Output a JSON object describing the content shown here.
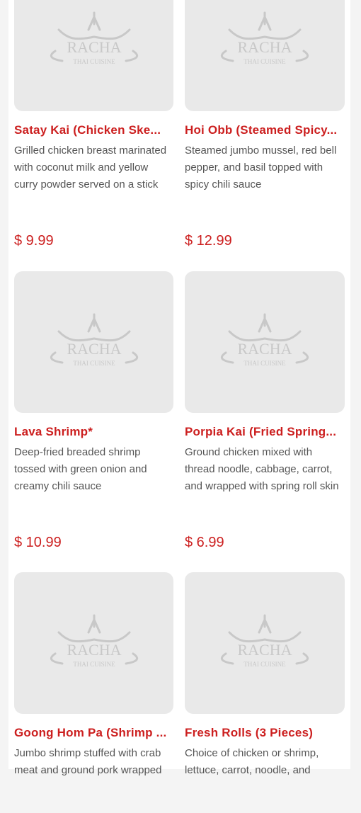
{
  "logo": {
    "brand": "RACHA",
    "subtitle": "THAI CUISINE"
  },
  "menu_items": [
    {
      "name": "Satay Kai (Chicken Ske...",
      "description": "Grilled chicken breast marinated with coconut milk and yellow curry powder served on a stick",
      "price": "$ 9.99"
    },
    {
      "name": "Hoi Obb (Steamed Spicy...",
      "description": "Steamed jumbo mussel, red bell pepper, and basil topped with spicy chili sauce",
      "price": "$ 12.99"
    },
    {
      "name": "Lava Shrimp*",
      "description": "Deep-fried breaded shrimp tossed with green onion and creamy chili sauce",
      "price": "$ 10.99"
    },
    {
      "name": "Porpia Kai (Fried Spring...",
      "description": "Ground chicken mixed with thread noodle, cabbage, carrot, and wrapped with spring roll skin",
      "price": "$ 6.99"
    },
    {
      "name": "Goong Hom Pa (Shrimp ...",
      "description": "Jumbo shrimp stuffed with crab meat and ground pork wrapped",
      "price": ""
    },
    {
      "name": "Fresh Rolls (3 Pieces)",
      "description": "Choice of chicken or shrimp, lettuce, carrot, noodle, and",
      "price": ""
    }
  ]
}
